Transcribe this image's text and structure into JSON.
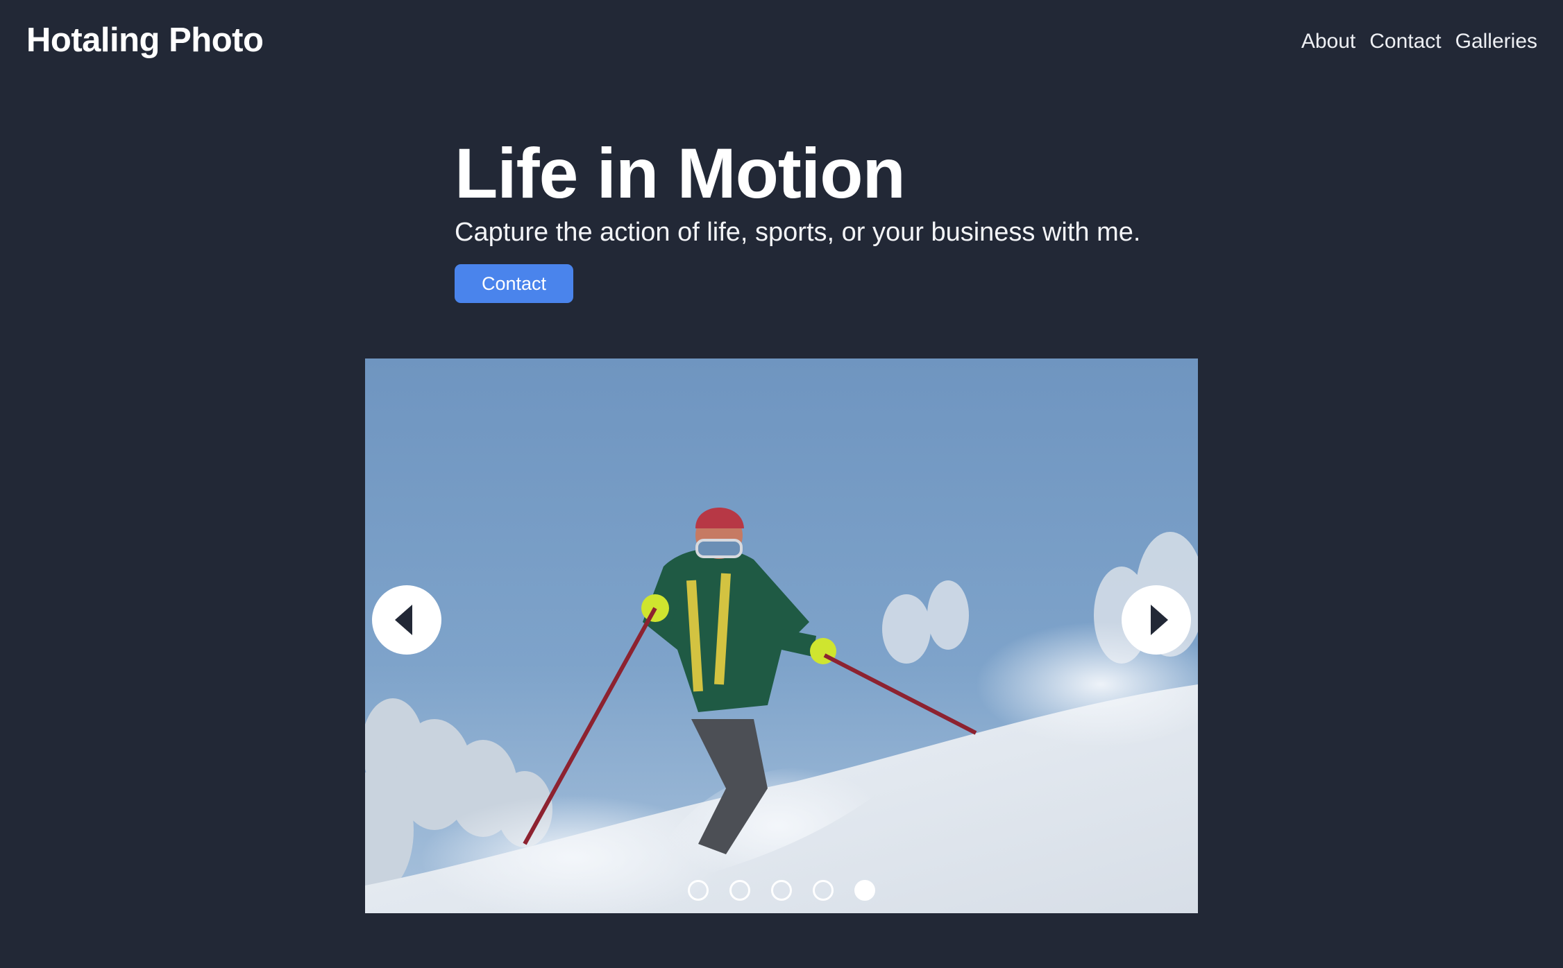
{
  "header": {
    "brand": "Hotaling Photo",
    "nav": [
      "About",
      "Contact",
      "Galleries"
    ]
  },
  "hero": {
    "title": "Life in Motion",
    "subtitle": "Capture the action of life, sports, or your business with me.",
    "cta_label": "Contact"
  },
  "carousel": {
    "slide_count": 5,
    "active_index": 4,
    "prev_icon": "chevron-left-icon",
    "next_icon": "chevron-right-icon"
  },
  "colors": {
    "background": "#222836",
    "accent": "#4a84ec",
    "text": "#ffffff"
  }
}
